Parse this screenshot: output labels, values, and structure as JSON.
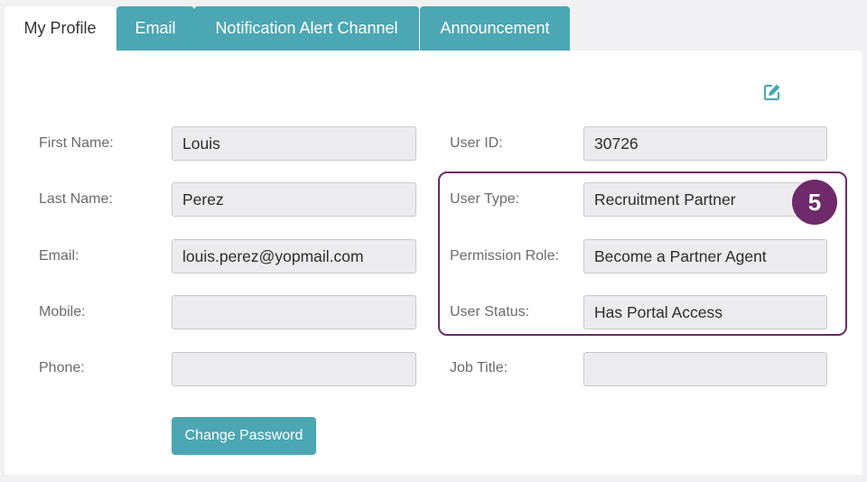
{
  "tabs": [
    {
      "label": "My Profile",
      "active": true
    },
    {
      "label": "Email",
      "active": false
    },
    {
      "label": "Notification Alert Channel",
      "active": false
    },
    {
      "label": "Announcement",
      "active": false
    }
  ],
  "edit_icon": "edit-pencil-square-icon",
  "left_fields": [
    {
      "label": "First Name:",
      "value": "Louis"
    },
    {
      "label": "Last Name:",
      "value": "Perez"
    },
    {
      "label": "Email:",
      "value": "louis.perez@yopmail.com"
    },
    {
      "label": "Mobile:",
      "value": ""
    },
    {
      "label": "Phone:",
      "value": ""
    }
  ],
  "right_fields": [
    {
      "label": "User ID:",
      "value": "30726"
    },
    {
      "label": "User Type:",
      "value": "Recruitment Partner"
    },
    {
      "label": "Permission Role:",
      "value": "Become a Partner Agent"
    },
    {
      "label": "User Status:",
      "value": "Has Portal Access"
    },
    {
      "label": "Job Title:",
      "value": ""
    }
  ],
  "step_badge": "5",
  "change_password_label": "Change Password",
  "colors": {
    "accent": "#4ba7b3",
    "highlight": "#6e2a6a",
    "field_bg": "#ececee"
  }
}
